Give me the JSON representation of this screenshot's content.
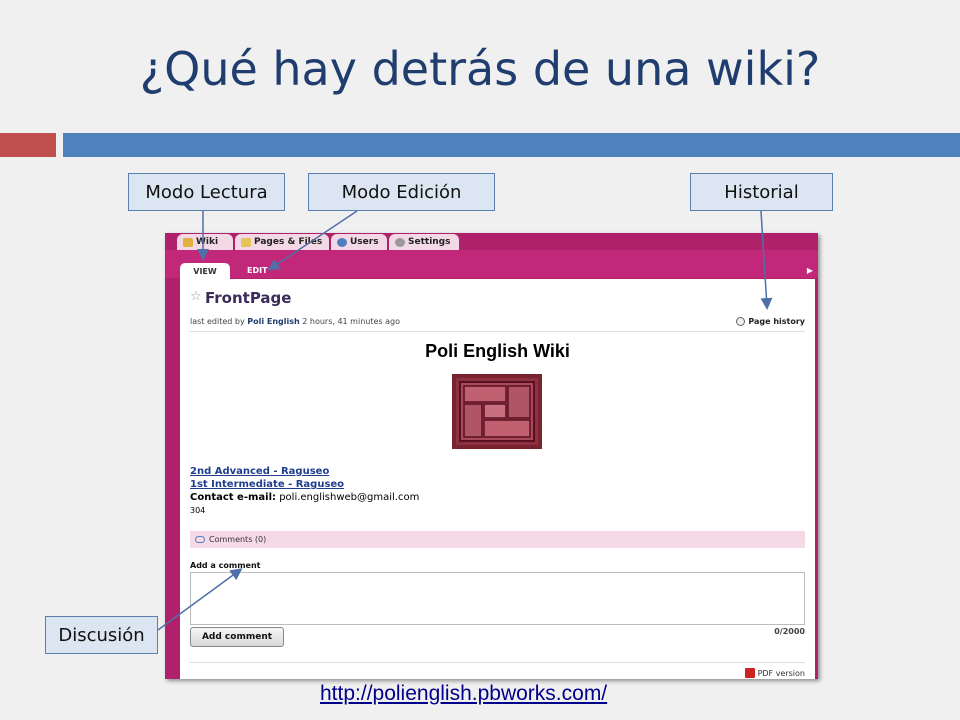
{
  "slide": {
    "title": "¿Qué hay detrás de una wiki?",
    "footer_link": "http://polienglish.pbworks.com/",
    "callouts": {
      "lectura": "Modo Lectura",
      "edicion": "Modo Edición",
      "historial": "Historial",
      "discusion": "Discusión"
    }
  },
  "wiki": {
    "tabs": [
      "Wiki",
      "Pages & Files",
      "Users",
      "Settings"
    ],
    "view_tab": "VIEW",
    "edit_tab": "EDIT",
    "page_title": "FrontPage",
    "meta_prefix": "last edited by",
    "meta_user": "Poli English",
    "meta_time": "2 hours, 41 minutes ago",
    "page_history": "Page history",
    "heading": "Poli English Wiki",
    "links": [
      "2nd Advanced - Raguseo",
      "1st Intermediate - Raguseo"
    ],
    "contact_label": "Contact e-mail:",
    "contact_value": "poli.englishweb@gmail.com",
    "count": "304",
    "comments": "Comments (0)",
    "add_comment_label": "Add a comment",
    "char_count": "0/2000",
    "add_comment_button": "Add comment",
    "pdf_version": "PDF version"
  },
  "colors": {
    "title": "#1f3d6e",
    "accent_red": "#c0504d",
    "accent_blue": "#4f81bd",
    "wiki_magenta": "#b0216b",
    "callout_fill": "#dce6f2"
  }
}
